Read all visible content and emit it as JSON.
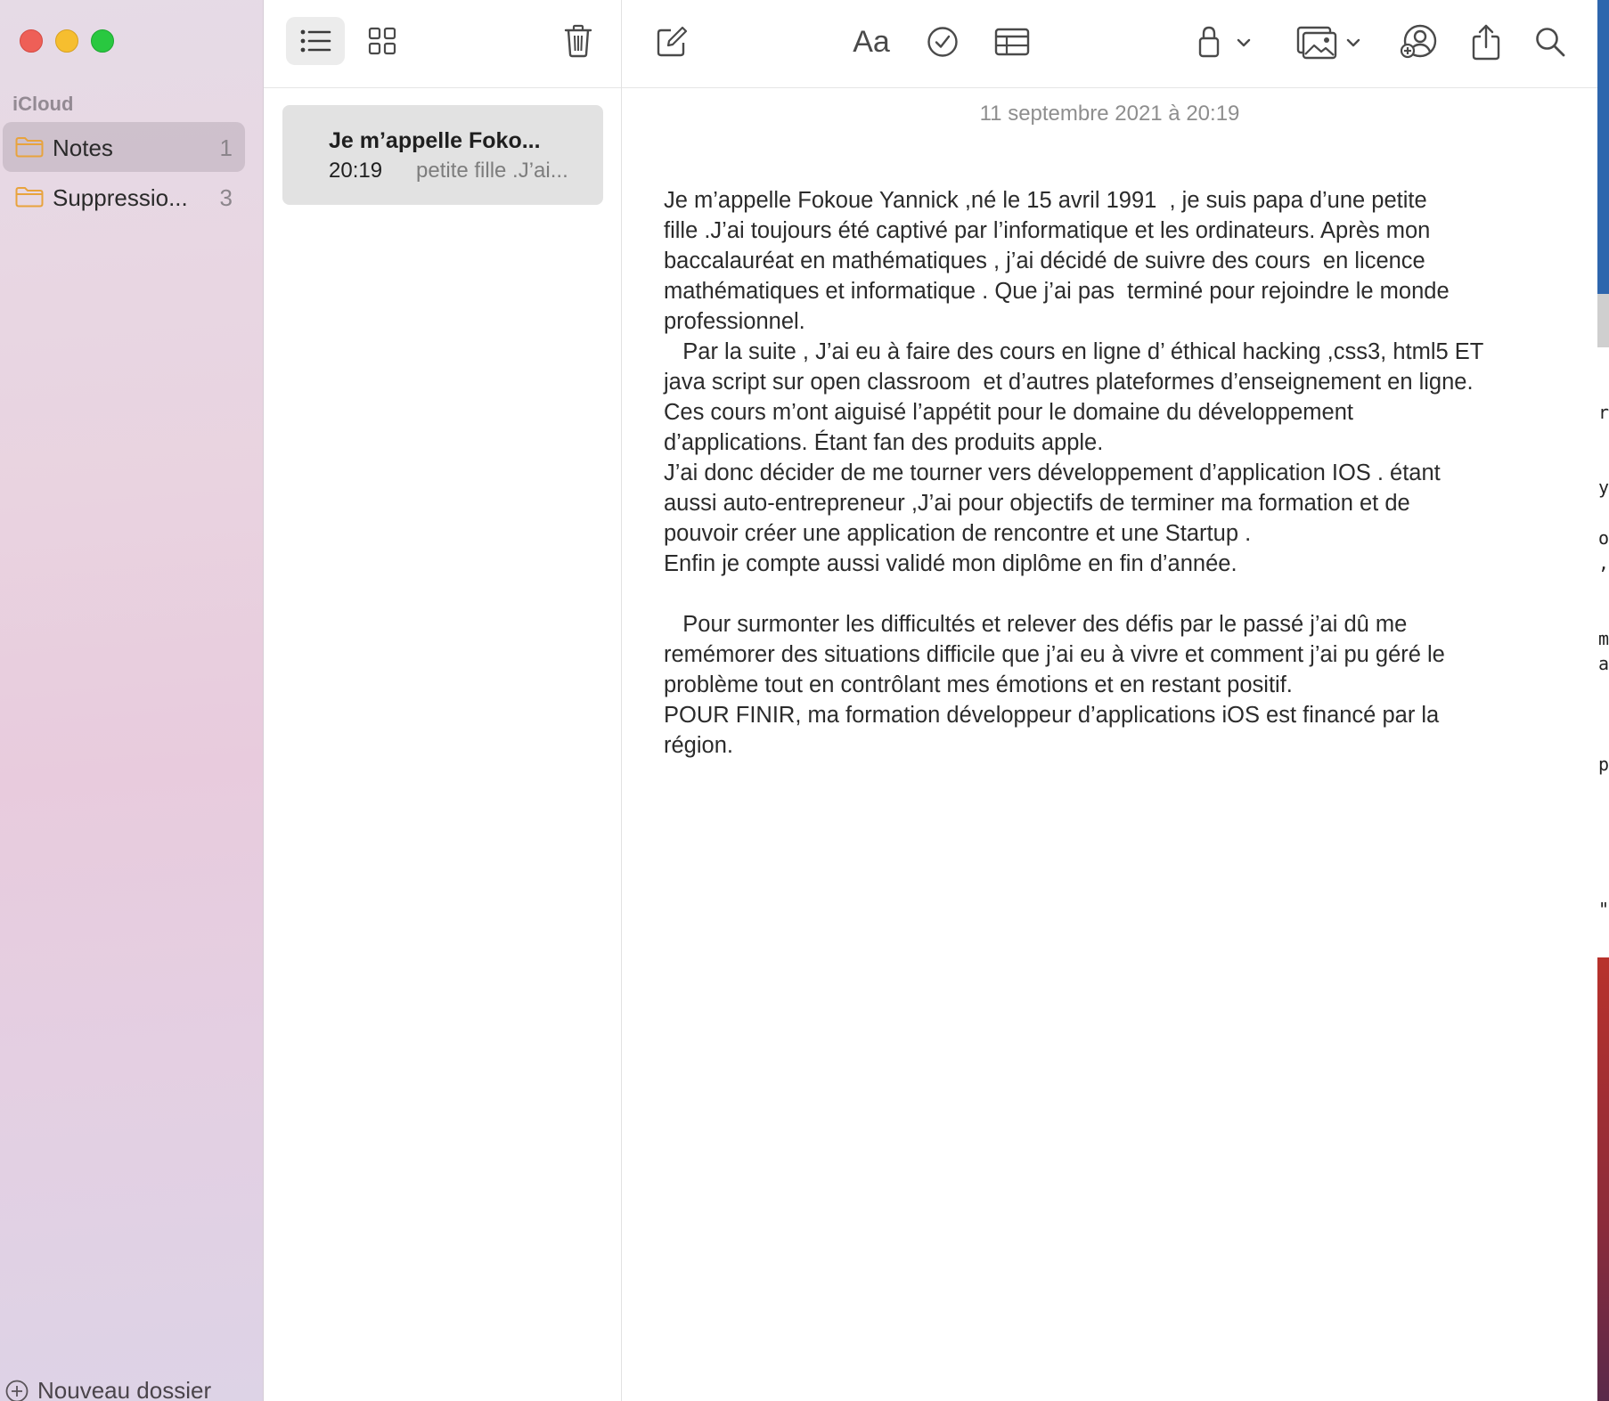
{
  "window": {
    "traffic_lights": [
      "close",
      "minimize",
      "maximize"
    ]
  },
  "sidebar": {
    "section_label": "iCloud",
    "folders": [
      {
        "name": "Notes",
        "count": "1",
        "selected": true,
        "icon": "folder-icon"
      },
      {
        "name": "Suppressio...",
        "count": "3",
        "selected": false,
        "icon": "folder-icon"
      }
    ],
    "new_folder_label": "Nouveau dossier"
  },
  "list_toolbar": {
    "buttons": [
      "list-view-icon",
      "gallery-view-icon",
      "trash-icon"
    ]
  },
  "notes_list": [
    {
      "title": "Je m’appelle Foko...",
      "time": "20:19",
      "preview": "petite fille .J’ai..."
    }
  ],
  "editor_toolbar": {
    "format_label": "Aa",
    "buttons": [
      "compose-icon",
      "format-icon",
      "checklist-icon",
      "table-icon",
      "lock-icon",
      "media-icon",
      "collaborate-icon",
      "share-icon",
      "search-icon"
    ]
  },
  "note": {
    "date": "11 septembre 2021 à 20:19",
    "body": "Je m’appelle Fokoue Yannick ,né le 15 avril 1991  , je suis papa d’une petite\nfille .J’ai toujours été captivé par l’informatique et les ordinateurs. Après mon\nbaccalauréat en mathématiques , j’ai décidé de suivre des cours  en licence\nmathématiques et informatique . Que j’ai pas  terminé pour rejoindre le monde\nprofessionnel.\n   Par la suite , J’ai eu à faire des cours en ligne d’ éthical hacking ,css3, html5 ET\njava script sur open classroom  et d’autres plateformes d’enseignement en ligne.\nCes cours m’ont aiguisé l’appétit pour le domaine du développement\nd’applications. Étant fan des produits apple.\nJ’ai donc décider de me tourner vers développement d’application IOS . étant\naussi auto-entrepreneur ,J’ai pour objectifs de terminer ma formation et de\npouvoir créer une application de rencontre et une Startup .\nEnfin je compte aussi validé mon diplôme en fin d’année.\n\n   Pour surmonter les difficultés et relever des défis par le passé j’ai dû me\nremémorer des situations difficile que j’ai eu à vivre et comment j’ai pu géré le\nproblème tout en contrôlant mes émotions et en restant positif.\nPOUR FINIR, ma formation développeur d’applications iOS est financé par la\nrégion."
  },
  "edge_glyphs": [
    "r",
    "y",
    "o",
    ",",
    "m",
    "a",
    "p",
    "\""
  ],
  "colors": {
    "folder_accent": "#e8a33d",
    "close": "#ee5f57",
    "minimize": "#f6be2f",
    "maximize": "#29c840"
  }
}
